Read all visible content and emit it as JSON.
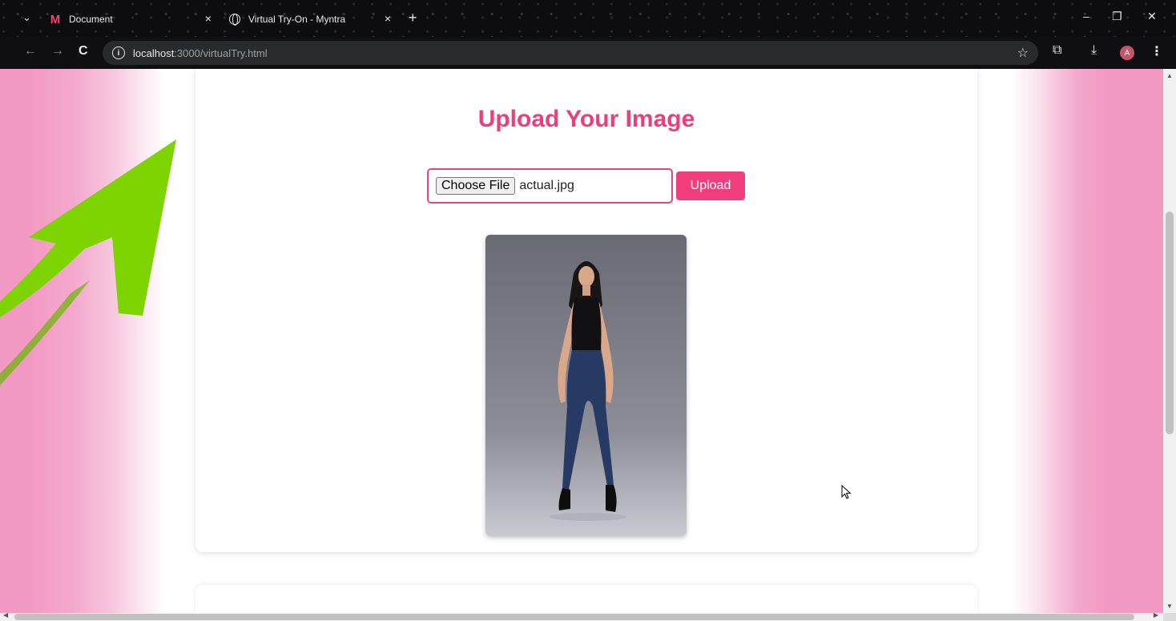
{
  "browser": {
    "tabs": [
      {
        "title": "Document",
        "favicon": "myntra-logo",
        "close": "×"
      },
      {
        "title": "Virtual Try-On - Myntra",
        "favicon": "globe-icon",
        "close": "×"
      }
    ],
    "new_tab": "+",
    "url_host": "localhost",
    "url_rest": ":3000/virtualTry.html",
    "profile_initial": "A",
    "icons": {
      "back": "←",
      "forward": "→",
      "reload": "C",
      "info": "i",
      "star": "☆",
      "extensions": "⧉",
      "download": "⤓",
      "menu": "⋮",
      "minimize": "–",
      "maximize": "❐",
      "close": "✕",
      "tab_caret": "⌄"
    }
  },
  "page": {
    "title": "Upload Your Image",
    "choose_file_label": "Choose File",
    "file_name": "actual.jpg",
    "upload_label": "Upload"
  },
  "colors": {
    "accent": "#ea3f7b",
    "button": "#f03e7d",
    "side_pink": "#f39ac4",
    "arrow_green": "#7ed400"
  }
}
